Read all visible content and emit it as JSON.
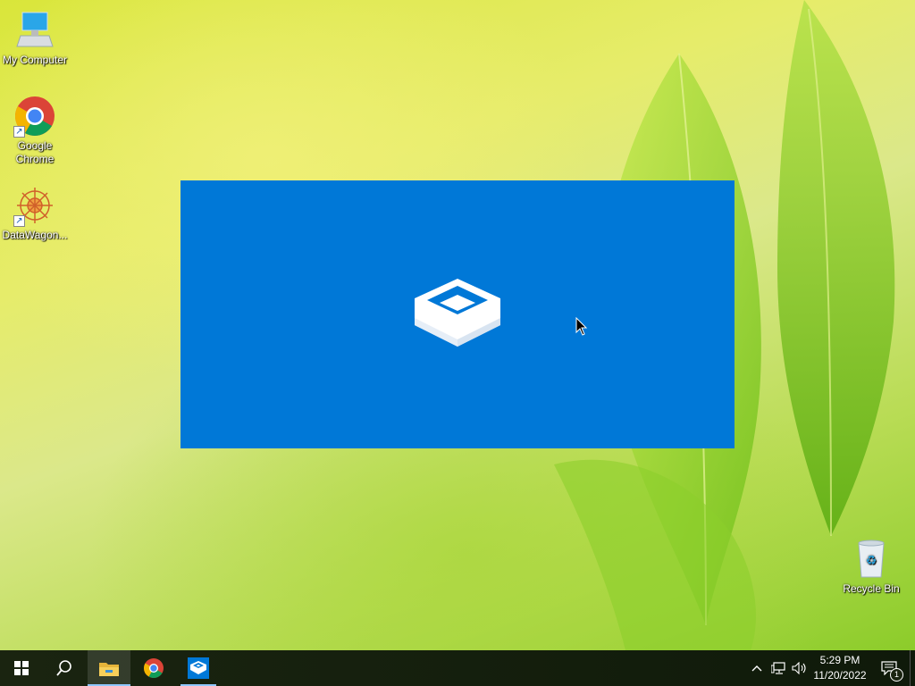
{
  "desktop": {
    "icons": [
      {
        "label": "My Computer",
        "icon": "computer-icon"
      },
      {
        "label": "Google Chrome",
        "icon": "chrome-icon"
      },
      {
        "label": "DataWagon...",
        "icon": "datawagon-icon"
      },
      {
        "label": "Recycle Bin",
        "icon": "recycle-bin-icon"
      }
    ]
  },
  "splash": {
    "icon": "sandbox-box-icon",
    "background": "#0078d7"
  },
  "taskbar": {
    "background": "#101a08",
    "buttons": [
      {
        "name": "start",
        "icon": "windows-logo-icon"
      },
      {
        "name": "search",
        "icon": "search-icon"
      },
      {
        "name": "file-explorer",
        "icon": "folder-icon",
        "state": "active"
      },
      {
        "name": "chrome",
        "icon": "chrome-icon"
      },
      {
        "name": "windows-sandbox",
        "icon": "sandbox-box-icon",
        "state": "running"
      }
    ],
    "tray": {
      "icons": [
        "chevron-up-icon",
        "network-icon",
        "volume-icon"
      ],
      "time": "5:29 PM",
      "date": "11/20/2022",
      "notification_count": "1"
    }
  }
}
